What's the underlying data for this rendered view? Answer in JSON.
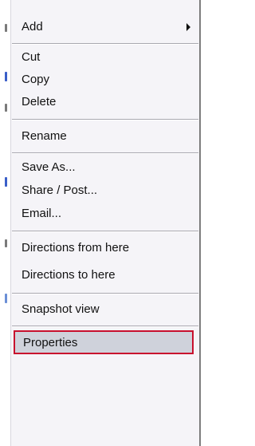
{
  "menu": {
    "items": [
      {
        "id": "add",
        "label": "Add",
        "has_submenu": true
      },
      {
        "id": "cut",
        "label": "Cut"
      },
      {
        "id": "copy",
        "label": "Copy"
      },
      {
        "id": "delete",
        "label": "Delete"
      },
      {
        "id": "rename",
        "label": "Rename"
      },
      {
        "id": "save-as",
        "label": "Save As..."
      },
      {
        "id": "share-post",
        "label": "Share / Post..."
      },
      {
        "id": "email",
        "label": "Email..."
      },
      {
        "id": "directions-from",
        "label": "Directions from here"
      },
      {
        "id": "directions-to",
        "label": "Directions to here"
      },
      {
        "id": "snapshot-view",
        "label": "Snapshot view"
      },
      {
        "id": "properties",
        "label": "Properties",
        "highlighted": true
      }
    ]
  },
  "colors": {
    "menu_bg": "#f5f4f8",
    "highlight_bg": "#cfd2db",
    "highlight_border": "#c8102e",
    "separator": "#a9a8b0"
  }
}
